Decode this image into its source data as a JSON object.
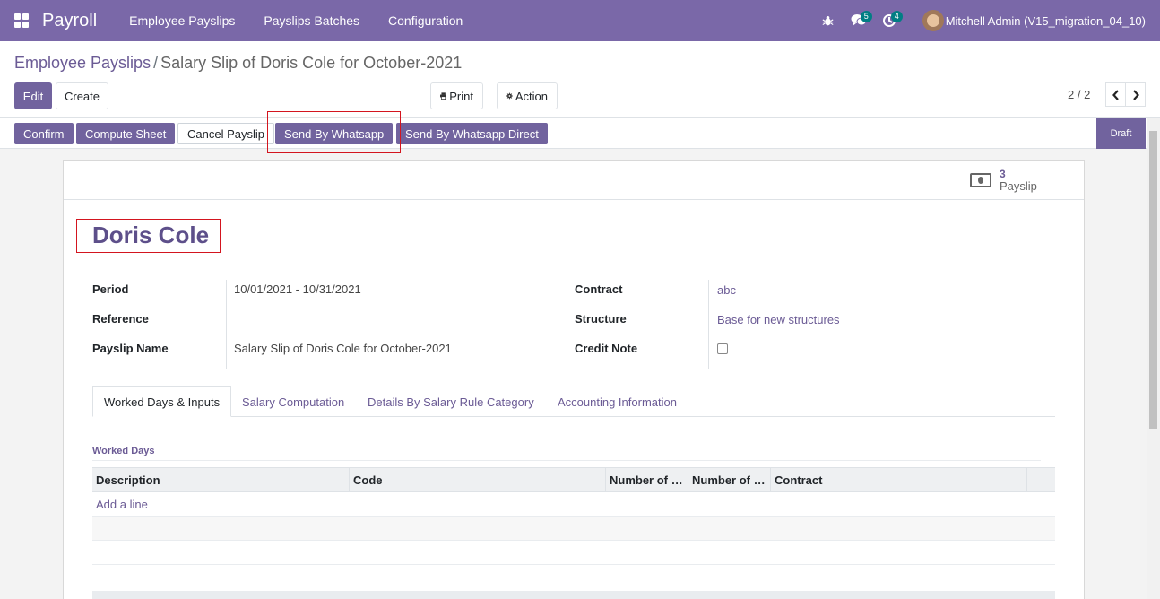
{
  "navbar": {
    "brand": "Payroll",
    "menu": [
      "Employee Payslips",
      "Payslips Batches",
      "Configuration"
    ],
    "messages_count": "5",
    "activities_count": "4",
    "user_name": "Mitchell Admin (V15_migration_04_10)"
  },
  "breadcrumb": {
    "parent": "Employee Payslips",
    "separator": "/",
    "current": "Salary Slip of Doris Cole for October-2021"
  },
  "control": {
    "edit_label": "Edit",
    "create_label": "Create",
    "print_label": "Print",
    "action_label": "Action",
    "pager": "2 / 2"
  },
  "statusbar": {
    "confirm": "Confirm",
    "compute_sheet": "Compute Sheet",
    "cancel_payslip": "Cancel Payslip",
    "send_whatsapp": "Send By Whatsapp",
    "send_whatsapp_direct": "Send By Whatsapp Direct",
    "state": "Draft"
  },
  "smart_button": {
    "count": "3",
    "label": "Payslip"
  },
  "form": {
    "employee": "Doris Cole",
    "period_label": "Period",
    "period_value": "10/01/2021 - 10/31/2021",
    "reference_label": "Reference",
    "reference_value": "",
    "payslip_name_label": "Payslip Name",
    "payslip_name_value": "Salary Slip of Doris Cole for October-2021",
    "contract_label": "Contract",
    "contract_value": "abc",
    "structure_label": "Structure",
    "structure_value": "Base for new structures",
    "credit_note_label": "Credit Note"
  },
  "tabs": [
    "Worked Days & Inputs",
    "Salary Computation",
    "Details By Salary Rule Category",
    "Accounting Information"
  ],
  "worked_days": {
    "title": "Worked Days",
    "columns": [
      "Description",
      "Code",
      "Number of …",
      "Number of …",
      "Contract"
    ],
    "add_line": "Add a line"
  },
  "colors": {
    "brand": "#7a68a8",
    "primary": "#71639e",
    "highlight": "#d3151f"
  }
}
